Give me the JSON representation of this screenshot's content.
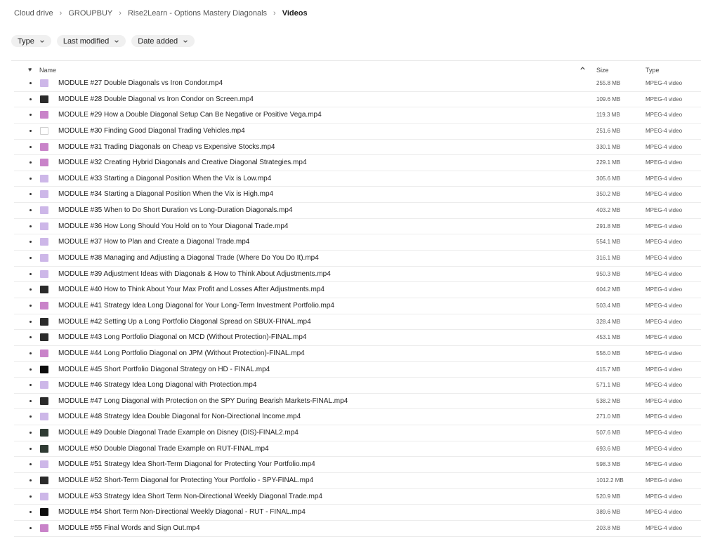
{
  "breadcrumb": [
    "Cloud drive",
    "GROUPBUY",
    "Rise2Learn - Options Mastery Diagonals",
    "Videos"
  ],
  "filters": [
    "Type",
    "Last modified",
    "Date added"
  ],
  "columns": {
    "name": "Name",
    "size": "Size",
    "type": "Type"
  },
  "thumb_colors": {
    "lavender": "#cdb7e8",
    "dark": "#2b2b2b",
    "black": "#0d0d0d",
    "pink": "#c983c9",
    "white": "#ffffff",
    "darkgreen": "#2f3b33"
  },
  "files": [
    {
      "name": "MODULE #27 Double Diagonals vs Iron Condor.mp4",
      "size": "255.8 MB",
      "type": "MPEG-4 video",
      "thumb": "lavender"
    },
    {
      "name": "MODULE #28 Double Diagonal vs Iron Condor on Screen.mp4",
      "size": "109.6 MB",
      "type": "MPEG-4 video",
      "thumb": "dark"
    },
    {
      "name": "MODULE #29 How a Double Diagonal Setup Can Be Negative or Positive Vega.mp4",
      "size": "119.3 MB",
      "type": "MPEG-4 video",
      "thumb": "pink"
    },
    {
      "name": "MODULE #30 Finding Good Diagonal Trading Vehicles.mp4",
      "size": "251.6 MB",
      "type": "MPEG-4 video",
      "thumb": "white"
    },
    {
      "name": "MODULE #31 Trading Diagonals on Cheap vs Expensive Stocks.mp4",
      "size": "330.1 MB",
      "type": "MPEG-4 video",
      "thumb": "pink"
    },
    {
      "name": "MODULE #32 Creating Hybrid Diagonals and Creative Diagonal Strategies.mp4",
      "size": "229.1 MB",
      "type": "MPEG-4 video",
      "thumb": "pink"
    },
    {
      "name": "MODULE #33 Starting a Diagonal Position When the Vix is Low.mp4",
      "size": "305.6 MB",
      "type": "MPEG-4 video",
      "thumb": "lavender"
    },
    {
      "name": "MODULE #34 Starting a Diagonal Position When the Vix is High.mp4",
      "size": "350.2 MB",
      "type": "MPEG-4 video",
      "thumb": "lavender"
    },
    {
      "name": "MODULE #35 When to Do Short Duration vs Long-Duration Diagonals.mp4",
      "size": "403.2 MB",
      "type": "MPEG-4 video",
      "thumb": "lavender"
    },
    {
      "name": "MODULE #36 How Long Should You Hold on to Your Diagonal Trade.mp4",
      "size": "291.8 MB",
      "type": "MPEG-4 video",
      "thumb": "lavender"
    },
    {
      "name": "MODULE #37 How to Plan and Create a Diagonal Trade.mp4",
      "size": "554.1 MB",
      "type": "MPEG-4 video",
      "thumb": "lavender"
    },
    {
      "name": "MODULE #38 Managing and Adjusting a Diagonal Trade (Where Do You Do It).mp4",
      "size": "316.1 MB",
      "type": "MPEG-4 video",
      "thumb": "lavender"
    },
    {
      "name": "MODULE #39 Adjustment Ideas with Diagonals & How to Think About Adjustments.mp4",
      "size": "950.3 MB",
      "type": "MPEG-4 video",
      "thumb": "lavender"
    },
    {
      "name": "MODULE #40 How to Think About Your Max Profit and Losses After Adjustments.mp4",
      "size": "604.2 MB",
      "type": "MPEG-4 video",
      "thumb": "dark"
    },
    {
      "name": "MODULE #41 Strategy Idea Long Diagonal for Your Long-Term Investment Portfolio.mp4",
      "size": "503.4 MB",
      "type": "MPEG-4 video",
      "thumb": "pink"
    },
    {
      "name": "MODULE #42 Setting Up a Long Portfolio Diagonal Spread on SBUX-FINAL.mp4",
      "size": "328.4 MB",
      "type": "MPEG-4 video",
      "thumb": "dark"
    },
    {
      "name": "MODULE #43 Long Portfolio Diagonal on MCD (Without Protection)-FINAL.mp4",
      "size": "453.1 MB",
      "type": "MPEG-4 video",
      "thumb": "dark"
    },
    {
      "name": "MODULE #44 Long Portfolio Diagonal on JPM (Without Protection)-FINAL.mp4",
      "size": "556.0 MB",
      "type": "MPEG-4 video",
      "thumb": "pink"
    },
    {
      "name": "MODULE #45 Short Portfolio Diagonal Strategy on HD - FINAL.mp4",
      "size": "415.7 MB",
      "type": "MPEG-4 video",
      "thumb": "black"
    },
    {
      "name": "MODULE #46 Strategy Idea Long Diagonal with Protection.mp4",
      "size": "571.1 MB",
      "type": "MPEG-4 video",
      "thumb": "lavender"
    },
    {
      "name": "MODULE #47 Long Diagonal with Protection on the SPY During Bearish Markets-FINAL.mp4",
      "size": "538.2 MB",
      "type": "MPEG-4 video",
      "thumb": "dark"
    },
    {
      "name": "MODULE #48 Strategy Idea Double Diagonal for Non-Directional Income.mp4",
      "size": "271.0 MB",
      "type": "MPEG-4 video",
      "thumb": "lavender"
    },
    {
      "name": "MODULE #49 Double Diagonal Trade Example on Disney (DIS)-FINAL2.mp4",
      "size": "507.6 MB",
      "type": "MPEG-4 video",
      "thumb": "darkgreen"
    },
    {
      "name": "MODULE #50 Double Diagonal Trade Example on RUT-FINAL.mp4",
      "size": "693.6 MB",
      "type": "MPEG-4 video",
      "thumb": "darkgreen"
    },
    {
      "name": "MODULE #51 Strategy Idea Short-Term Diagonal for Protecting Your Portfolio.mp4",
      "size": "598.3 MB",
      "type": "MPEG-4 video",
      "thumb": "lavender"
    },
    {
      "name": "MODULE #52 Short-Term Diagonal for Protecting Your Portfolio - SPY-FINAL.mp4",
      "size": "1012.2 MB",
      "type": "MPEG-4 video",
      "thumb": "dark"
    },
    {
      "name": "MODULE #53 Strategy Idea Short Term Non-Directional Weekly Diagonal Trade.mp4",
      "size": "520.9 MB",
      "type": "MPEG-4 video",
      "thumb": "lavender"
    },
    {
      "name": "MODULE #54 Short Term Non-Directional Weekly Diagonal - RUT - FINAL.mp4",
      "size": "389.6 MB",
      "type": "MPEG-4 video",
      "thumb": "black"
    },
    {
      "name": "MODULE #55 Final Words and Sign Out.mp4",
      "size": "203.8 MB",
      "type": "MPEG-4 video",
      "thumb": "pink"
    }
  ]
}
